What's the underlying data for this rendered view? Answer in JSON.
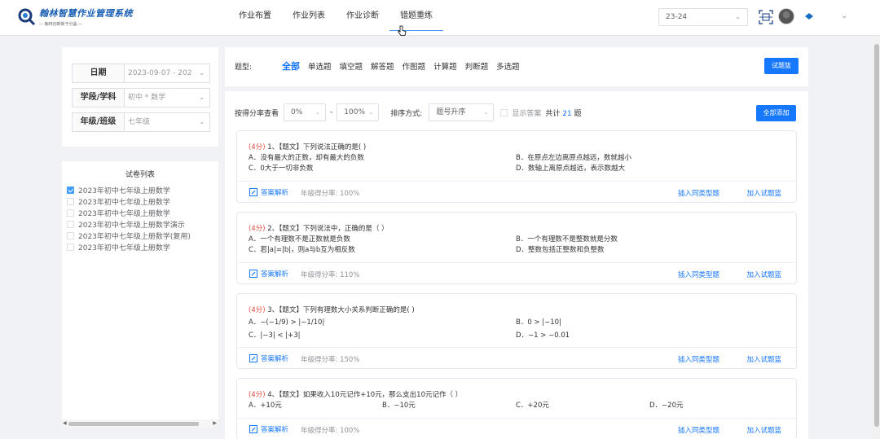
{
  "header": {
    "logo_title": "翰林智慧作业管理系统",
    "logo_subtitle": "— 翰林创新新于分晶 —",
    "nav": [
      "作业布置",
      "作业列表",
      "作业诊断",
      "错题重练"
    ],
    "active_nav": 3,
    "year": "23-24"
  },
  "filters": [
    {
      "label": "日期",
      "value": "2023-09-07 - 202"
    },
    {
      "label": "学段/学科",
      "value": "初中 * 数学"
    },
    {
      "label": "年级/班级",
      "value": "七年级"
    }
  ],
  "paper_list": {
    "title": "试卷列表",
    "items": [
      {
        "label": "2023年初中七年级上册数学",
        "checked": true
      },
      {
        "label": "2023年初中七年级上册数学",
        "checked": false
      },
      {
        "label": "2023年初中七年级上册数学",
        "checked": false
      },
      {
        "label": "2023年初中七年级上册数学演示",
        "checked": false
      },
      {
        "label": "2023年初中七年级上册数学(复用)",
        "checked": false
      },
      {
        "label": "2023年初中七年级上册数学",
        "checked": false
      }
    ]
  },
  "type_bar": {
    "label": "题型:",
    "tabs": [
      "全部",
      "单选题",
      "填空题",
      "解答题",
      "作图题",
      "计算题",
      "判断题",
      "多选题"
    ],
    "active": 0,
    "button": "试题篮"
  },
  "options": {
    "score_label": "按得分率查看",
    "score_min": "0%",
    "score_sep": "-",
    "score_max": "100%",
    "sort_label": "排序方式:",
    "sort_value": "题号升序",
    "show_answer": "显示答案",
    "total_prefix": "共计",
    "total_count": "21",
    "total_suffix": "题",
    "add_all": "全部添加"
  },
  "questions": [
    {
      "score": "(4分)",
      "stem": " 1、【题文】下列说法正确的是(    )",
      "options": [
        "A．没有最大的正数，却有最大的负数",
        "B．在原点左边离原点越远，数就越小",
        "C．0大于一切非负数",
        "D．数轴上离原点越远，表示数越大"
      ],
      "rate": "年级得分率: 100%"
    },
    {
      "score": "(4分)",
      "stem": " 2、【题文】下列说法中，正确的是（    ）",
      "options": [
        "A．一个有理数不是正数就是负数",
        "B．一个有理数不是整数就是分数",
        "C．若|a|=|b|，则a与b互为相反数",
        "D．整数包括正整数和负整数"
      ],
      "rate": "年级得分率: 110%"
    },
    {
      "score": "(4分)",
      "stem": " 3、【题文】下列有理数大小关系判断正确的是(    )",
      "options": [
        "A．−(−1/9) > |−1/10|",
        "B．0 > |−10|",
        "C．|−3| < |+3|",
        "D．−1 > −0.01"
      ],
      "rate": "年级得分率: 150%"
    },
    {
      "score": "(4分)",
      "stem": " 4、【题文】如果收入10元记作+10元，那么支出10元记作（    ）",
      "options": [
        "A．+10元",
        "B．−10元",
        "C．+20元",
        "D．−20元"
      ],
      "rate": "年级得分率: 100%"
    }
  ],
  "q_actions": {
    "answer": "答案解析",
    "insert": "插入同类型题",
    "add": "加入试题篮"
  }
}
